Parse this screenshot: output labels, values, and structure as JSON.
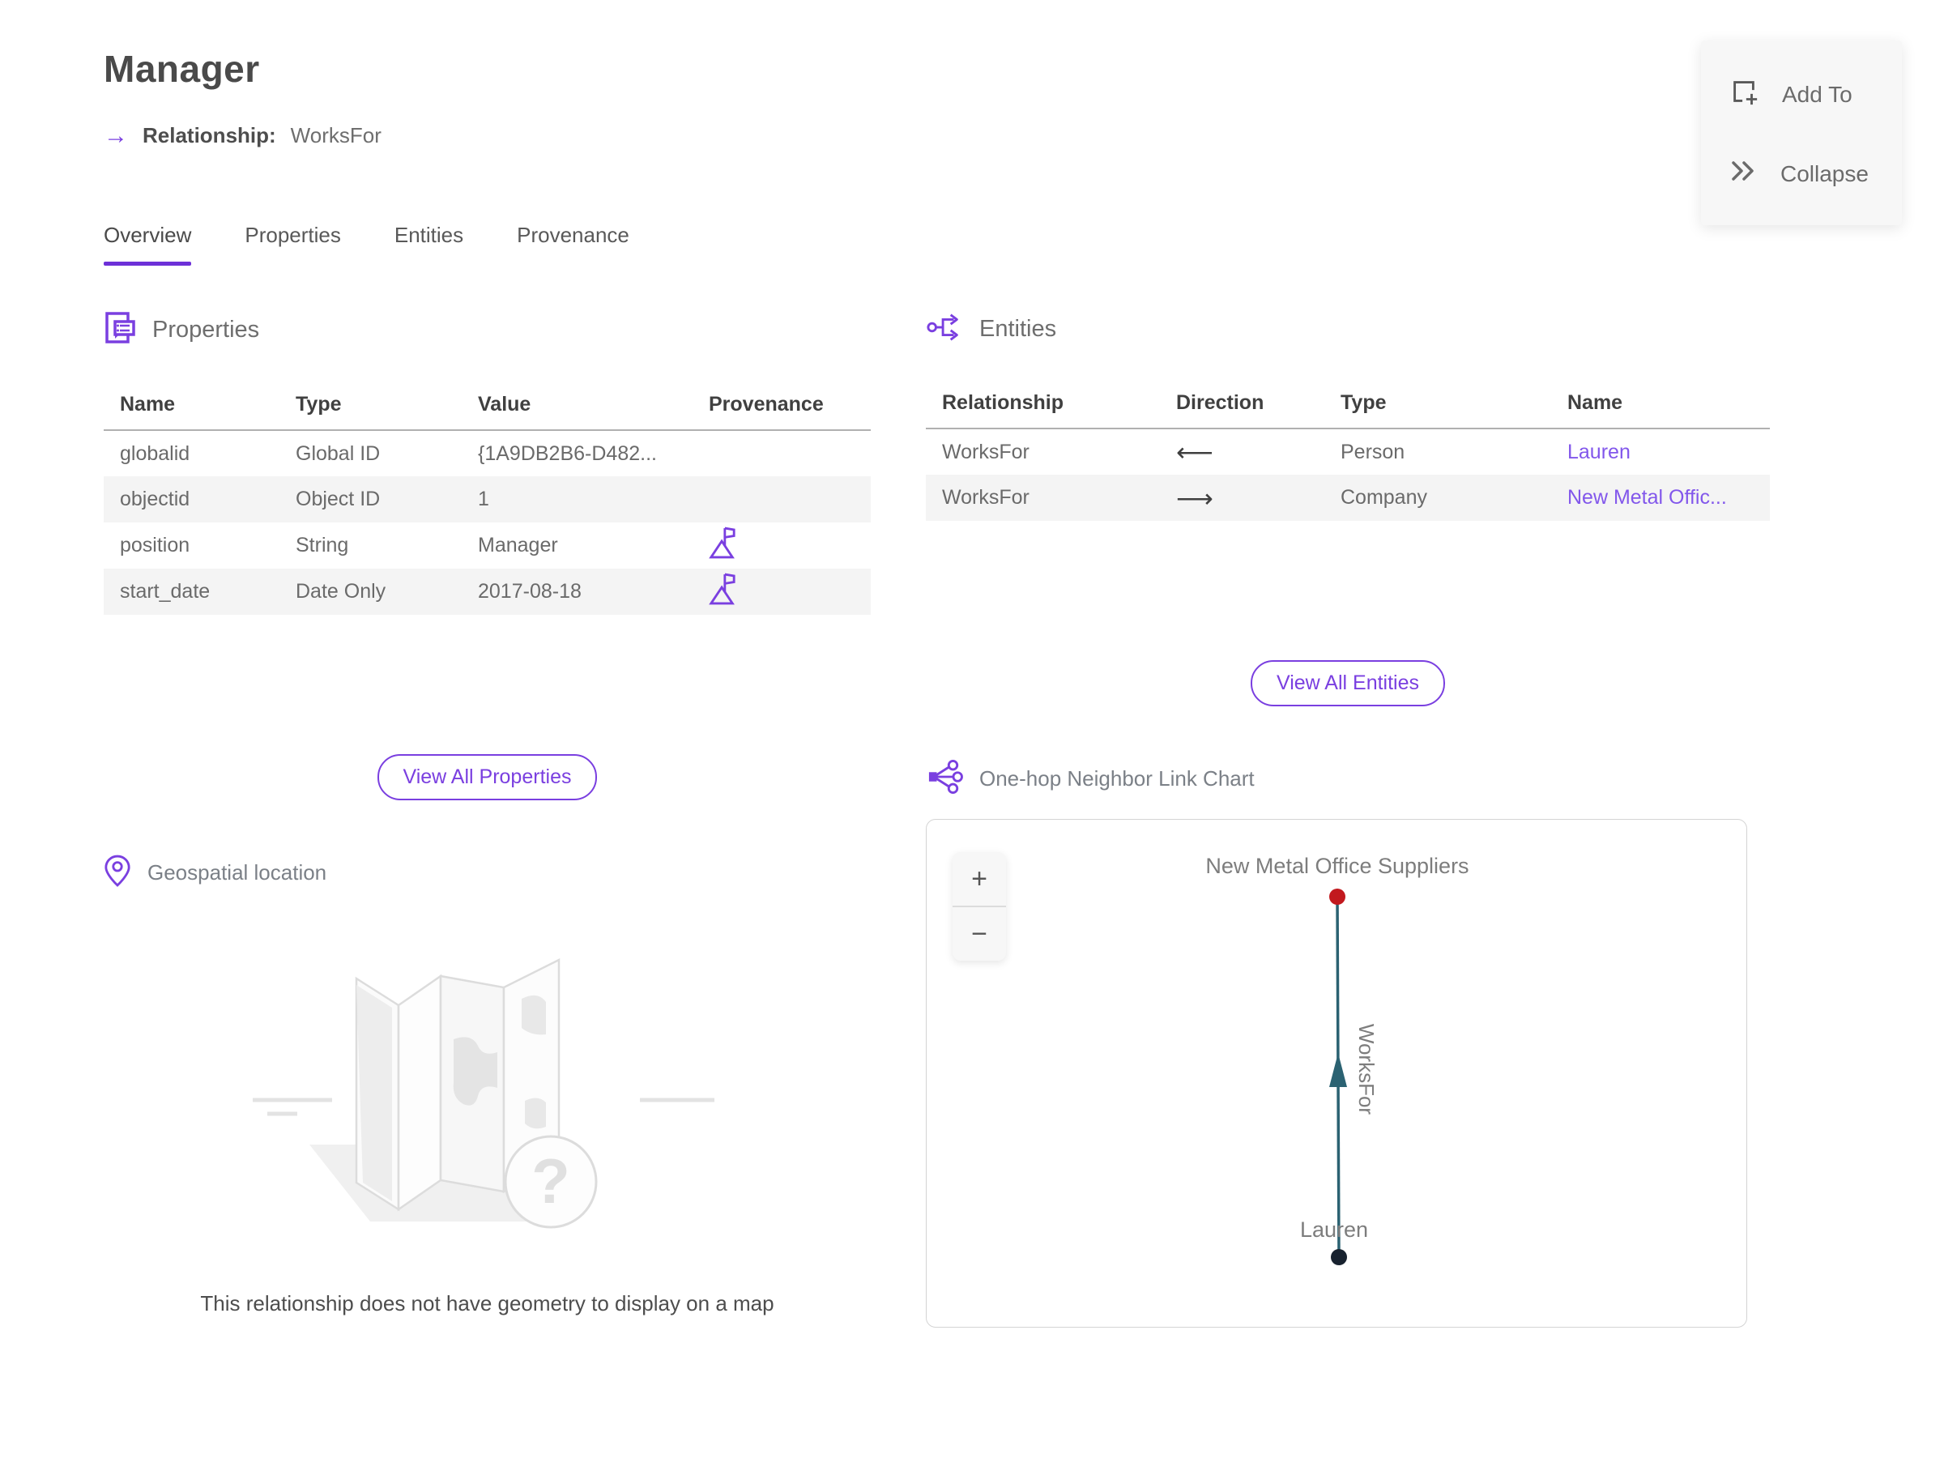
{
  "header": {
    "title": "Manager",
    "relationship_label": "Relationship:",
    "relationship_value": "WorksFor",
    "relationship_arrow": "→"
  },
  "actions": {
    "add_to_label": "Add To",
    "collapse_label": "Collapse"
  },
  "tabs": {
    "overview": "Overview",
    "properties": "Properties",
    "entities": "Entities",
    "provenance": "Provenance"
  },
  "properties_section": {
    "title": "Properties",
    "headers": {
      "name": "Name",
      "type": "Type",
      "value": "Value",
      "provenance": "Provenance"
    },
    "rows": [
      {
        "name": "globalid",
        "type": "Global ID",
        "value": "{1A9DB2B6-D482...",
        "has_provenance": false
      },
      {
        "name": "objectid",
        "type": "Object ID",
        "value": "1",
        "has_provenance": false
      },
      {
        "name": "position",
        "type": "String",
        "value": "Manager",
        "has_provenance": true
      },
      {
        "name": "start_date",
        "type": "Date Only",
        "value": "2017-08-18",
        "has_provenance": true
      }
    ],
    "view_all_label": "View All Properties"
  },
  "entities_section": {
    "title": "Entities",
    "headers": {
      "relationship": "Relationship",
      "direction": "Direction",
      "type": "Type",
      "name": "Name"
    },
    "rows": [
      {
        "relationship": "WorksFor",
        "direction": "⟵",
        "type": "Person",
        "name": "Lauren"
      },
      {
        "relationship": "WorksFor",
        "direction": "⟶",
        "type": "Company",
        "name": "New Metal Offic..."
      }
    ],
    "view_all_label": "View All Entities"
  },
  "geospatial": {
    "title": "Geospatial location",
    "empty_message": "This relationship does not have geometry to display on a map"
  },
  "link_chart": {
    "title": "One-hop Neighbor Link Chart",
    "zoom_in_label": "+",
    "zoom_out_label": "−",
    "nodes": [
      {
        "label": "New Metal Office Suppliers",
        "color": "#c2191e"
      },
      {
        "label": "Lauren",
        "color": "#18222f"
      }
    ],
    "edge": {
      "label": "WorksFor",
      "color": "#2b6272"
    }
  },
  "colors": {
    "accent": "#7a3fe0",
    "link": "#8257eb",
    "edge_teal": "#2b6272",
    "node_red": "#c2191e",
    "node_navy": "#18222f"
  }
}
